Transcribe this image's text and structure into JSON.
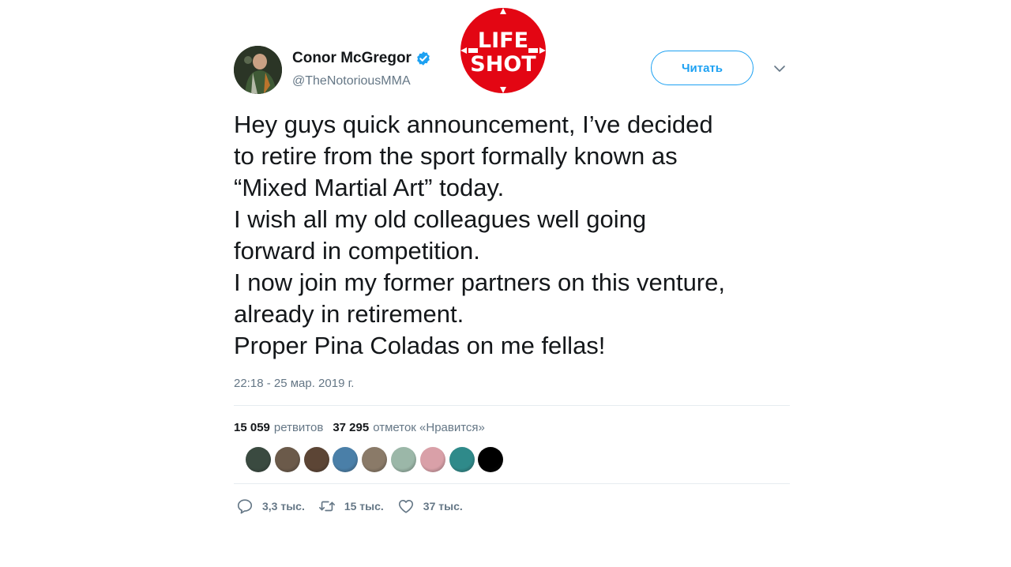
{
  "tweet": {
    "author": {
      "name": "Conor McGregor",
      "handle": "@TheNotoriousMMA",
      "verified": true,
      "avatar_icon": "user-avatar-photo"
    },
    "follow_label": "Читать",
    "text_lines": [
      "Hey guys quick announcement, I’ve decided",
      "to retire from the sport formally known as",
      "“Mixed Martial Art” today.",
      "I wish all my old colleagues well going",
      "forward in competition.",
      "I now join my former partners on this venture,",
      "already in retirement.",
      "Proper Pina Coladas on me fellas!"
    ],
    "timestamp": "22:18 - 25 мар. 2019 г.",
    "stats": {
      "retweets_count": "15 059",
      "retweets_label": "ретвитов",
      "likes_count": "37 295",
      "likes_label": "отметок «Нравится»"
    },
    "likers": [
      {
        "icon": "liker-avatar",
        "color": "#3a4a40"
      },
      {
        "icon": "liker-avatar",
        "color": "#6b5a4a"
      },
      {
        "icon": "liker-avatar",
        "color": "#5c4535"
      },
      {
        "icon": "liker-avatar",
        "color": "#4a7fa8"
      },
      {
        "icon": "liker-avatar",
        "color": "#8a7a68"
      },
      {
        "icon": "liker-avatar",
        "color": "#9bb7a8"
      },
      {
        "icon": "liker-avatar",
        "color": "#d9a0a8"
      },
      {
        "icon": "liker-avatar",
        "color": "#2f8a8a"
      },
      {
        "icon": "liker-avatar",
        "color": "#000000"
      }
    ],
    "actions": {
      "reply": {
        "icon": "reply-icon",
        "count": "3,3 тыс."
      },
      "retweet": {
        "icon": "retweet-icon",
        "count": "15 тыс."
      },
      "like": {
        "icon": "heart-icon",
        "count": "37 тыс."
      }
    }
  },
  "watermark": {
    "line1": "LIFE",
    "line2": "SHOT",
    "color": "#e30613"
  },
  "colors": {
    "accent": "#1da1f2",
    "secondary_text": "#657786",
    "divider": "#e6ecf0"
  }
}
